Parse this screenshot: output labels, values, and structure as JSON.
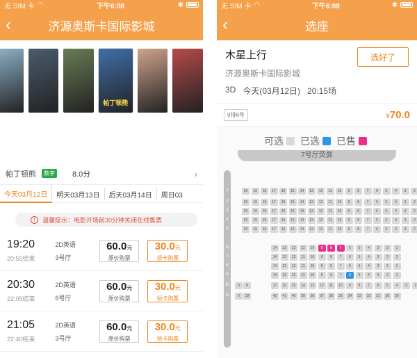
{
  "status": {
    "carrier": "无 SIM 卡",
    "time": "下午6:08"
  },
  "left": {
    "title": "济源奥斯卡国际影城",
    "posters": [
      {
        "label": "",
        "color": "#8fb3c9"
      },
      {
        "label": "",
        "color": "#4a5c6d"
      },
      {
        "label": "",
        "color": "#6a7c55"
      },
      {
        "label": "帕丁顿熊",
        "color": "#3f6fa8"
      },
      {
        "label": "",
        "color": "#cfa48c"
      },
      {
        "label": "",
        "color": "#b64a4a"
      }
    ],
    "movie": {
      "name": "帕丁顿熊",
      "tag": "数字",
      "score": "8.0分"
    },
    "dates": [
      "今天03月12日",
      "明天03月13日",
      "后天03月14日",
      "周日03"
    ],
    "notice": "温馨提示：电影开场前30分钟关闭在线售票",
    "shows": [
      {
        "start": "19:20",
        "end": "20:55结束",
        "type": "2D英语",
        "hall": "3号厅",
        "price": "60.0",
        "price_label": "原价购票",
        "card_price": "30.0",
        "card_label": "领卡购票"
      },
      {
        "start": "20:30",
        "end": "22:05结束",
        "type": "2D英语",
        "hall": "6号厅",
        "price": "60.0",
        "price_label": "原价购票",
        "card_price": "30.0",
        "card_label": "领卡购票"
      },
      {
        "start": "21:05",
        "end": "22:40结束",
        "type": "2D英语",
        "hall": "3号厅",
        "price": "60.0",
        "price_label": "原价购票",
        "card_price": "30.0",
        "card_label": "领卡购票"
      }
    ],
    "currency_unit": "元"
  },
  "right": {
    "title": "选座",
    "movie_title": "木星上行",
    "cinema": "济源奥斯卡国际影城",
    "format": "3D",
    "date": "今天(03月12日)",
    "time": "20:15场",
    "select_done": "选好了",
    "chosen_seat": "9排6号",
    "total": "70.0",
    "currency": "¥",
    "legend": {
      "available": "可选",
      "selected": "已选",
      "sold": "已售"
    },
    "screen": "7号厅荧屏",
    "colors": {
      "accent": "#f08520",
      "sold": "#e8308b",
      "mine": "#2c95e6",
      "available": "#d8d8d8"
    },
    "rows": [
      {
        "label": "1",
        "seats": [
          "20",
          "19",
          "18",
          "17",
          "16",
          "15",
          "14",
          "13",
          "12",
          "11",
          "10",
          "9",
          "8",
          "7",
          "6",
          "5",
          "4",
          "3",
          "2",
          "1"
        ]
      },
      {
        "label": "2",
        "seats": [
          "20",
          "19",
          "18",
          "17",
          "16",
          "15",
          "14",
          "13",
          "12",
          "11",
          "10",
          "9",
          "8",
          "7",
          "6",
          "5",
          "4",
          "3",
          "2",
          "1"
        ]
      },
      {
        "label": "3",
        "seats": [
          "20",
          "19",
          "18",
          "17",
          "16",
          "15",
          "14",
          "13",
          "12",
          "11",
          "10",
          "9",
          "8",
          "7",
          "6",
          "5",
          "4",
          "3",
          "2",
          "1"
        ]
      },
      {
        "label": "4",
        "seats": [
          "20",
          "19",
          "18",
          "17",
          "16",
          "15",
          "14",
          "13",
          "12",
          "11",
          "10",
          "9",
          "8",
          "7",
          "6",
          "5",
          "4",
          "3",
          "2",
          "1"
        ]
      },
      {
        "label": "5",
        "seats": [
          "20",
          "19",
          "18",
          "17",
          "16",
          "15",
          "14",
          "13",
          "12",
          "11",
          "10",
          "9",
          "8",
          "7",
          "6",
          "5",
          "4",
          "3",
          "2",
          "1"
        ]
      },
      {
        "label": "6",
        "seats": [
          "14",
          "13",
          "12",
          "11",
          "10",
          "9",
          "8",
          "7",
          "6",
          "5",
          "4",
          "3",
          "2",
          "1"
        ]
      },
      {
        "label": "7",
        "seats": [
          "14",
          "13",
          "12",
          "11",
          "10",
          "9",
          "8",
          "7",
          "6",
          "5",
          "4",
          "3",
          "2",
          "1"
        ]
      },
      {
        "label": "8",
        "seats": [
          "14",
          "13",
          "12",
          "11",
          "10",
          "9",
          "8",
          "7",
          "6",
          "5",
          "4",
          "3",
          "2",
          "1"
        ]
      },
      {
        "label": "9",
        "seats": [
          "14",
          "13",
          "12",
          "11",
          "10",
          "9",
          "8",
          "7",
          "6",
          "5",
          "4",
          "3",
          "2",
          "1"
        ]
      },
      {
        "label": "10",
        "seats": [
          "17",
          "16",
          "15",
          "14",
          "13",
          "12",
          "11",
          "10",
          "9",
          "8",
          "7",
          "6",
          "5",
          "4",
          "3",
          "2",
          "1"
        ]
      },
      {
        "label": "11",
        "seats": [
          "42",
          "41",
          "40",
          "39",
          "38",
          "37",
          "36",
          "35",
          "34",
          "33",
          "32",
          "31",
          "30",
          "29"
        ]
      }
    ],
    "aisle_seats": {
      "10": [
        "9",
        "8"
      ],
      "11": [
        "0",
        "19"
      ]
    },
    "sold_seats": [
      [
        "6",
        "9"
      ],
      [
        "6",
        "8"
      ],
      [
        "6",
        "7"
      ]
    ],
    "my_seats": [
      [
        "9",
        "6"
      ]
    ]
  }
}
